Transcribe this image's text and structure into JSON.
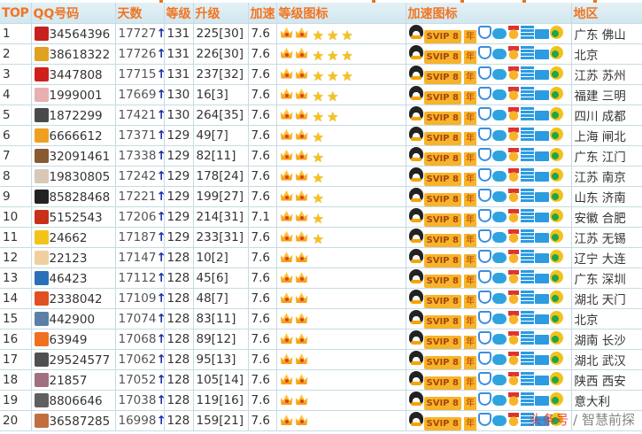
{
  "headers": {
    "top": "TOP",
    "qq": "QQ号码",
    "days": "天数",
    "level": "等级",
    "upgrade": "升级",
    "speed": "加速",
    "level_icons": "等级图标",
    "accel_icons": "加速图标",
    "region": "地区"
  },
  "badges": {
    "svip": "SVIP 8",
    "year": "年"
  },
  "arrow": "↑",
  "watermark": {
    "brand": "头条号",
    "sep": "/",
    "author": "智慧前探"
  },
  "colors": {
    "header_text": "#f07522",
    "header_bg": "#d9ebf2",
    "grid": "#c6dbe3",
    "arrow": "#1a2aa8"
  },
  "rows": [
    {
      "rank": "1",
      "qq": "34564396",
      "days": "17727",
      "level": "131",
      "upgrade": "225[30]",
      "speed": "7.6",
      "crowns": 2,
      "stars": 3,
      "region": "广东 佛山",
      "avatar": "#c8201e"
    },
    {
      "rank": "2",
      "qq": "38618322",
      "days": "17726",
      "level": "131",
      "upgrade": "226[30]",
      "speed": "7.6",
      "crowns": 2,
      "stars": 3,
      "region": "北京",
      "avatar": "#e0a020"
    },
    {
      "rank": "3",
      "qq": "3447808",
      "days": "17715",
      "level": "131",
      "upgrade": "237[32]",
      "speed": "7.6",
      "crowns": 2,
      "stars": 3,
      "region": "江苏 苏州",
      "avatar": "#d0201c"
    },
    {
      "rank": "4",
      "qq": "1999001",
      "days": "17669",
      "level": "130",
      "upgrade": "16[3]",
      "speed": "7.6",
      "crowns": 2,
      "stars": 2,
      "region": "福建 三明",
      "avatar": "#e8b0b0"
    },
    {
      "rank": "5",
      "qq": "1872299",
      "days": "17421",
      "level": "130",
      "upgrade": "264[35]",
      "speed": "7.6",
      "crowns": 2,
      "stars": 2,
      "region": "四川 成都",
      "avatar": "#4a4a4a"
    },
    {
      "rank": "6",
      "qq": "6666612",
      "days": "17371",
      "level": "129",
      "upgrade": "49[7]",
      "speed": "7.6",
      "crowns": 2,
      "stars": 1,
      "region": "上海 闸北",
      "avatar": "#f0a020"
    },
    {
      "rank": "7",
      "qq": "32091461",
      "days": "17338",
      "level": "129",
      "upgrade": "82[11]",
      "speed": "7.6",
      "crowns": 2,
      "stars": 1,
      "region": "广东 江门",
      "avatar": "#8a5a30"
    },
    {
      "rank": "8",
      "qq": "19830805",
      "days": "17242",
      "level": "129",
      "upgrade": "178[24]",
      "speed": "7.6",
      "crowns": 2,
      "stars": 1,
      "region": "江苏 南京",
      "avatar": "#d8c8b8"
    },
    {
      "rank": "9",
      "qq": "85828468",
      "days": "17221",
      "level": "129",
      "upgrade": "199[27]",
      "speed": "7.6",
      "crowns": 2,
      "stars": 1,
      "region": "山东 济南",
      "avatar": "#222222"
    },
    {
      "rank": "10",
      "qq": "5152543",
      "days": "17206",
      "level": "129",
      "upgrade": "214[31]",
      "speed": "7.1",
      "crowns": 2,
      "stars": 1,
      "region": "安徽 合肥",
      "avatar": "#c83018"
    },
    {
      "rank": "11",
      "qq": "24662",
      "days": "17187",
      "level": "129",
      "upgrade": "233[31]",
      "speed": "7.6",
      "crowns": 2,
      "stars": 1,
      "region": "江苏 无锡",
      "avatar": "#f2c418"
    },
    {
      "rank": "12",
      "qq": "22123",
      "days": "17147",
      "level": "128",
      "upgrade": "10[2]",
      "speed": "7.6",
      "crowns": 2,
      "stars": 0,
      "region": "辽宁 大连",
      "avatar": "#f0d0a0"
    },
    {
      "rank": "13",
      "qq": "46423",
      "days": "17112",
      "level": "128",
      "upgrade": "45[6]",
      "speed": "7.6",
      "crowns": 2,
      "stars": 0,
      "region": "广东 深圳",
      "avatar": "#2a70b8"
    },
    {
      "rank": "14",
      "qq": "2338042",
      "days": "17109",
      "level": "128",
      "upgrade": "48[7]",
      "speed": "7.6",
      "crowns": 2,
      "stars": 0,
      "region": "湖北 天门",
      "avatar": "#e05020"
    },
    {
      "rank": "15",
      "qq": "442900",
      "days": "17074",
      "level": "128",
      "upgrade": "83[11]",
      "speed": "7.6",
      "crowns": 2,
      "stars": 0,
      "region": "北京",
      "avatar": "#5a80a8"
    },
    {
      "rank": "16",
      "qq": "63949",
      "days": "17068",
      "level": "128",
      "upgrade": "89[12]",
      "speed": "7.6",
      "crowns": 2,
      "stars": 0,
      "region": "湖南 长沙",
      "avatar": "#f07020"
    },
    {
      "rank": "17",
      "qq": "29524577",
      "days": "17062",
      "level": "128",
      "upgrade": "95[13]",
      "speed": "7.6",
      "crowns": 2,
      "stars": 0,
      "region": "湖北 武汉",
      "avatar": "#505050"
    },
    {
      "rank": "18",
      "qq": "21857",
      "days": "17052",
      "level": "128",
      "upgrade": "105[14]",
      "speed": "7.6",
      "crowns": 2,
      "stars": 0,
      "region": "陕西 西安",
      "avatar": "#a07080"
    },
    {
      "rank": "19",
      "qq": "8806646",
      "days": "17038",
      "level": "128",
      "upgrade": "119[16]",
      "speed": "7.6",
      "crowns": 2,
      "stars": 0,
      "region": "意大利",
      "avatar": "#606060"
    },
    {
      "rank": "20",
      "qq": "36587285",
      "days": "16998",
      "level": "128",
      "upgrade": "159[21]",
      "speed": "7.6",
      "crowns": 2,
      "stars": 0,
      "region": "",
      "avatar": "#c07040"
    }
  ]
}
